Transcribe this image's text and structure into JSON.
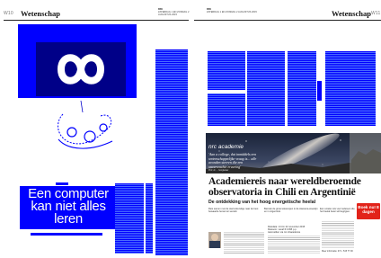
{
  "header_left": {
    "page_number": "W10",
    "section": "Wetenschap",
    "mid_title": "nrc",
    "mid_date": "ZATERDAG 1 EN ZONDAG 2 AUGUSTUS 2015"
  },
  "header_right": {
    "mid_title": "nrc",
    "mid_date": "ZATERDAG 1 EN ZONDAG 2 AUGUSTUS 2015",
    "section": "Wetenschap",
    "page_number": "W11"
  },
  "left_page": {
    "hero_title": "Een computer kan niet alles leren"
  },
  "right_page": {
    "feature_label": "nrc academie",
    "quote": "'Aan a college, dat inmiddels een wetenschappelijke vraag is... alle avonden sterren die een onverwachte ervaring'",
    "quote_author": "Prof. dr. ... hoogleraar",
    "headline": "Academiereis naar wereldberoemde observatoria in Chili en Argentinië",
    "subheadline": "De ontdekking van het hoog energetische heelal",
    "badge": "Boek nu! 8 dagen",
    "phone_line": "Meer informatie: 071 - 515 77 00",
    "intro_lines": [
      "Reis samen met de sterrenkundige naar de best bewaarde hemel ter wereld.",
      "Bezoek de grote telescopen in de Atacama-woestijn en in Argentinië.",
      "Een unieke reis voor iedereen die het heelal beter wil begrijpen."
    ],
    "box_lines": [
      "Reisdata: 14 t/m 22 november 2015",
      "Reissom: vanaf € 3.995 p.p.",
      "Aanmelden via nrc.nl/academie"
    ]
  }
}
